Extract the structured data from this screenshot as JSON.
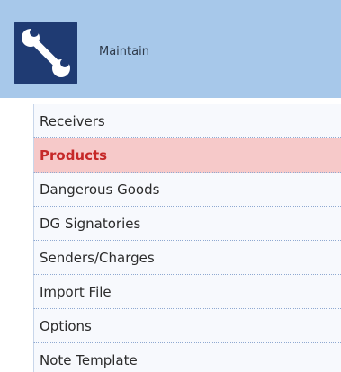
{
  "header": {
    "icon": "wrench-icon",
    "title": "Maintain"
  },
  "menu": {
    "items": [
      {
        "label": "Receivers",
        "active": false
      },
      {
        "label": "Products",
        "active": true
      },
      {
        "label": "Dangerous Goods",
        "active": false
      },
      {
        "label": "DG Signatories",
        "active": false
      },
      {
        "label": "Senders/Charges",
        "active": false
      },
      {
        "label": "Import File",
        "active": false
      },
      {
        "label": "Options",
        "active": false
      },
      {
        "label": "Note Template",
        "active": false
      }
    ]
  },
  "colors": {
    "header_bg": "#a7c8ea",
    "icon_bg": "#1f3b73",
    "active_bg": "#f6c9c9",
    "active_text": "#c62828",
    "item_bg": "#f7f9fd"
  }
}
